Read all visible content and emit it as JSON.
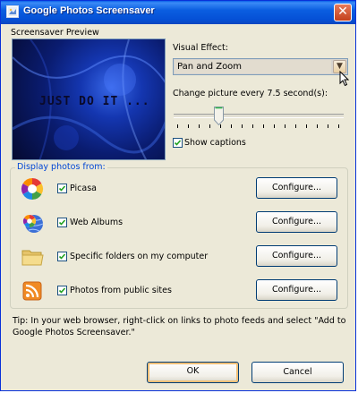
{
  "window": {
    "title": "Google Photos Screensaver",
    "close_symbol": "✕"
  },
  "preview": {
    "label": "Screensaver Preview",
    "image_text": "JUST  DO  IT  ..."
  },
  "visual_effect": {
    "label": "Visual Effect:",
    "selected": "Pan and Zoom",
    "arrow_symbol": "▼"
  },
  "change_picture": {
    "label": "Change picture every 7.5 second(s):",
    "slider_value_seconds": 7.5
  },
  "show_captions": {
    "label": "Show captions",
    "checked": true
  },
  "sources": {
    "group_title": "Display photos from:",
    "items": [
      {
        "label": "Picasa",
        "checked": true,
        "icon": "picasa-icon",
        "button": "Configure..."
      },
      {
        "label": "Web Albums",
        "checked": true,
        "icon": "web-albums-icon",
        "button": "Configure..."
      },
      {
        "label": "Specific folders on my computer",
        "checked": true,
        "icon": "folder-icon",
        "button": "Configure..."
      },
      {
        "label": "Photos from public sites",
        "checked": true,
        "icon": "rss-feed-icon",
        "button": "Configure..."
      }
    ]
  },
  "tip": "Tip: In your web browser, right-click on links to photo feeds and select \"Add to Google Photos Screensaver.\"",
  "buttons": {
    "ok": "OK",
    "cancel": "Cancel"
  },
  "colors": {
    "titlebar": "#0550d6",
    "group_title": "#0046d5",
    "dialog_bg": "#ece9d8"
  }
}
